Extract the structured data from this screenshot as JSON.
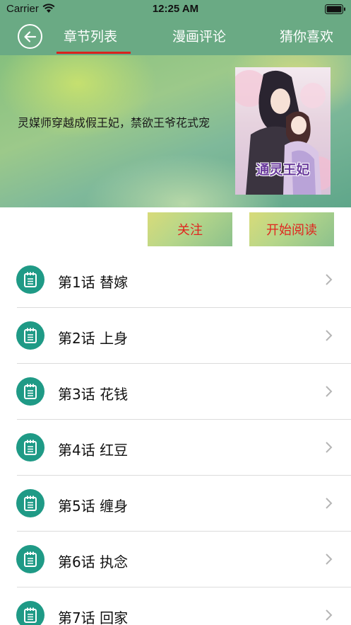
{
  "status_bar": {
    "carrier": "Carrier",
    "time": "12:25 AM"
  },
  "nav": {
    "tabs": [
      {
        "label": "章节列表",
        "active": true
      },
      {
        "label": "漫画评论",
        "active": false
      },
      {
        "label": "猜你喜欢",
        "active": false
      }
    ]
  },
  "banner": {
    "description": "灵媒师穿越成假王妃，禁欲王爷花式宠",
    "cover_title": "通灵王妃"
  },
  "actions": {
    "follow_label": "关注",
    "read_label": "开始阅读"
  },
  "chapters": [
    "第1话 替嫁",
    "第2话 上身",
    "第3话 花钱",
    "第4话 红豆",
    "第5话 缠身",
    "第6话 执念",
    "第7话 回家"
  ],
  "colors": {
    "header": "#6aaa84",
    "accent_red": "#d9221d",
    "icon_teal": "#1f9a86"
  }
}
